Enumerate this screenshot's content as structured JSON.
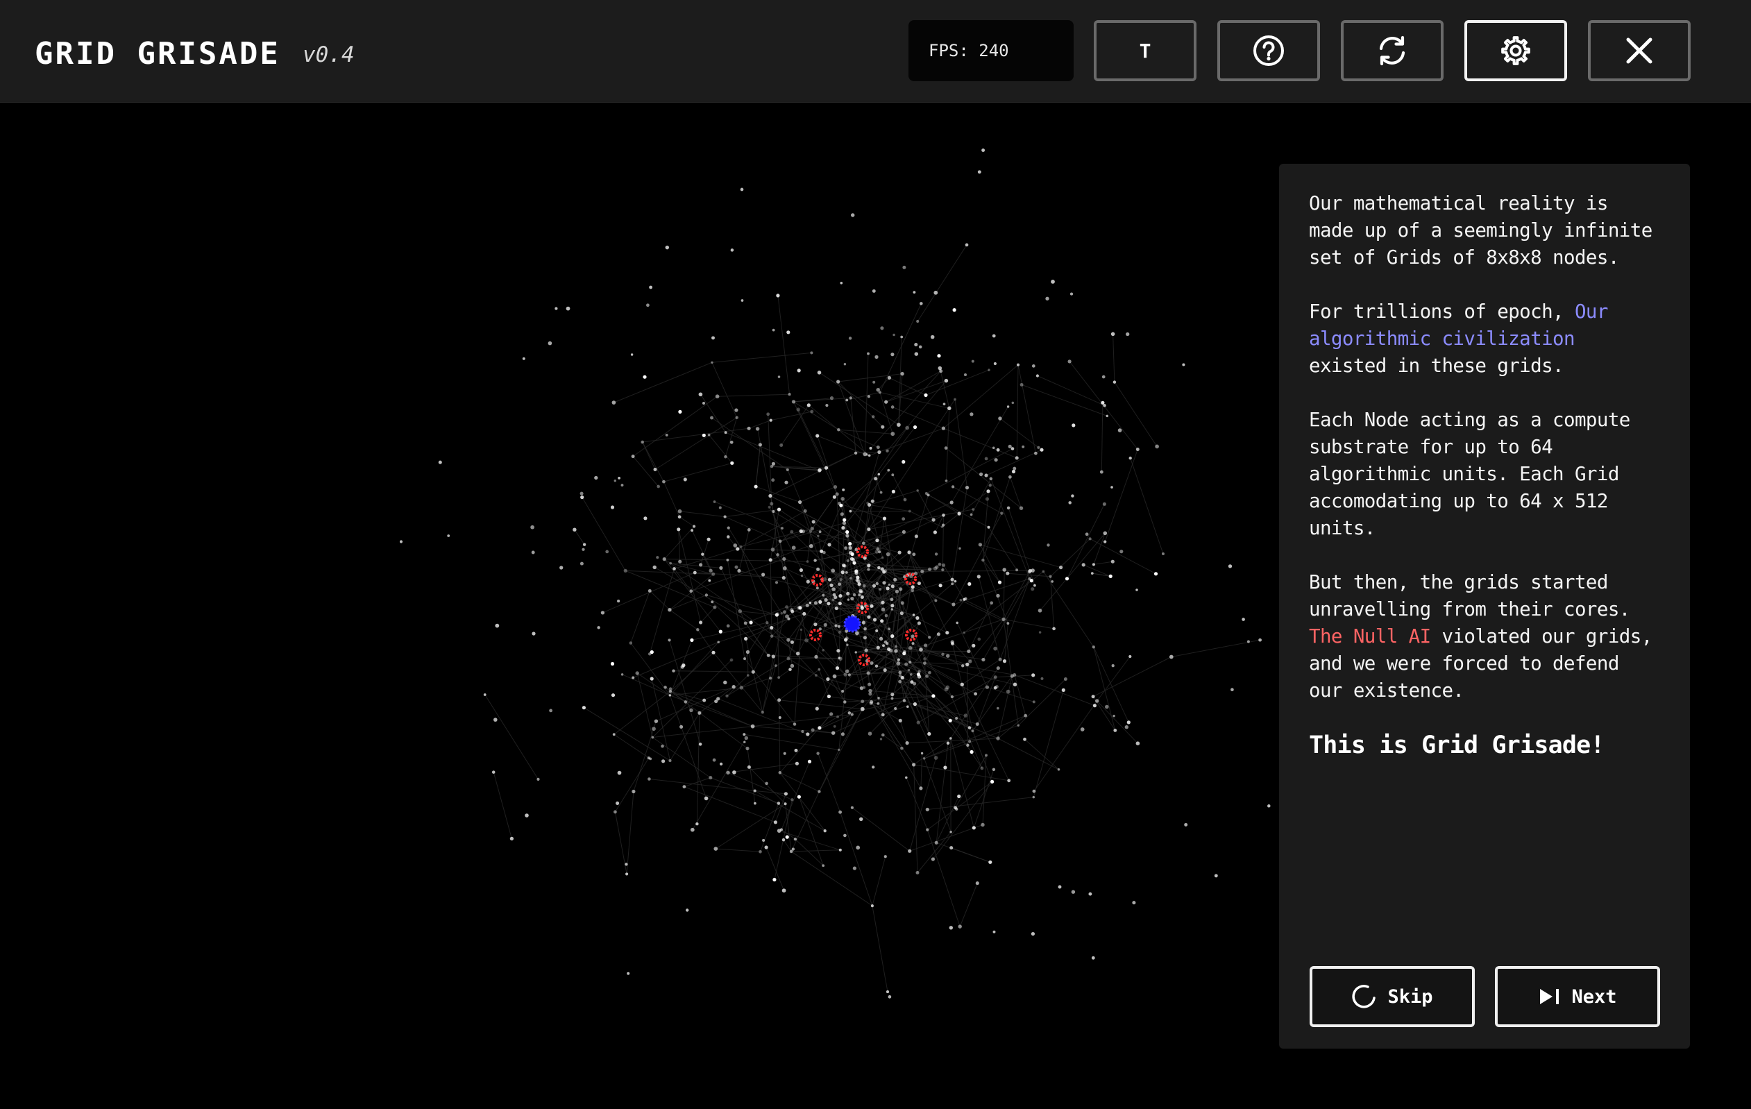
{
  "header": {
    "title": "GRID GRISADE",
    "version": "v0.4",
    "fps_text": "FPS: 240",
    "text_button_label": "T",
    "buttons": [
      {
        "name": "text-size-button",
        "icon": "letter-t-icon"
      },
      {
        "name": "help-button",
        "icon": "question-circle-icon"
      },
      {
        "name": "restart-button",
        "icon": "refresh-icon"
      },
      {
        "name": "settings-button",
        "icon": "gear-icon",
        "active": true
      },
      {
        "name": "close-button",
        "icon": "close-icon"
      }
    ]
  },
  "story": {
    "p1": "Our mathematical reality is made up of a seemingly infinite set of Grids of 8x8x8 nodes.",
    "p2_before": "For trillions of epoch, ",
    "p2_highlight": "Our algorithmic civilization",
    "p2_after": " existed in these grids.",
    "p3": "Each Node acting as a compute substrate for up to 64 algorithmic units. Each Grid accomodating up to 64 x 512 units.",
    "p4_before": "But then, the grids started unravelling from their cores. ",
    "p4_highlight": "The Null AI",
    "p4_after": " violated our grids, and we were forced to defend our existence.",
    "closing": "This is Grid Grisade!",
    "skip_label": "Skip",
    "next_label": "Next"
  },
  "colors": {
    "header_bg": "#1c1c1c",
    "panel_bg": "#1b1b1b",
    "highlight_blue": "#8c8cff",
    "highlight_red": "#ff6464",
    "player_node": "#1414ff",
    "enemy_node": "#ff2020"
  }
}
